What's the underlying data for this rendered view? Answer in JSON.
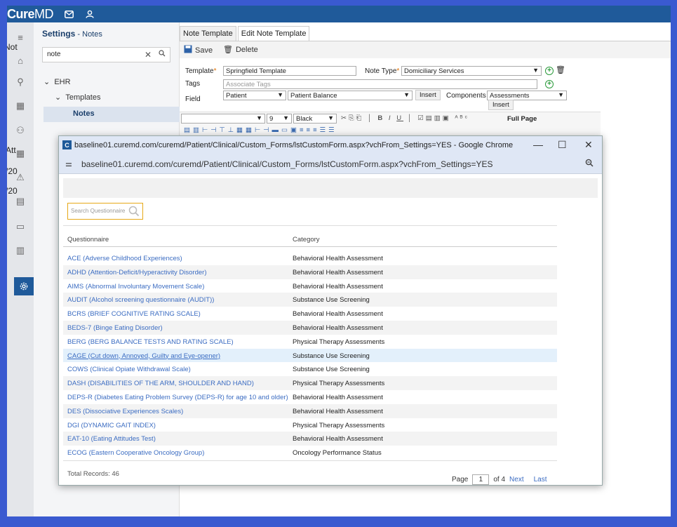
{
  "topbar": {
    "logo_bold": "Cure",
    "logo_rest": "MD"
  },
  "rail_cut_texts": [
    "Not",
    "Att",
    "/20",
    "/20"
  ],
  "settings": {
    "title": "Settings",
    "subtitle": " - Notes",
    "search_value": "note",
    "tree": {
      "ehr": "EHR",
      "templates": "Templates",
      "notes": "Notes"
    }
  },
  "tabs": [
    "Note Template",
    "Edit Note Template"
  ],
  "toolbar": {
    "save": "Save",
    "delete": "Delete"
  },
  "form": {
    "template_label": "Template",
    "template_value": "Springfield Template",
    "note_type_label": "Note Type",
    "note_type_value": "Domiciliary Services",
    "tags_label": "Tags",
    "tags_placeholder": "Associate Tags",
    "field_label": "Field",
    "field_value1": "Patient",
    "field_value2": "Patient Balance",
    "insert": "Insert",
    "components_label": "Components",
    "components_value": "Assessments",
    "insert2": "Insert"
  },
  "editor": {
    "size": "9",
    "color": "Black",
    "full_page": "Full Page"
  },
  "chrome": {
    "title": "baseline01.curemd.com/curemd/Patient/Clinical/Custom_Forms/lstCustomForm.aspx?vchFrom_Settings=YES - Google Chrome",
    "url": "baseline01.curemd.com/curemd/Patient/Clinical/Custom_Forms/lstCustomForm.aspx?vchFrom_Settings=YES"
  },
  "questionnaire": {
    "search_placeholder": "Search Questionnaire",
    "col_questionnaire": "Questionnaire",
    "col_category": "Category",
    "rows": [
      {
        "q": "ACE (Adverse Childhood Experiences)",
        "c": "Behavioral Health Assessment"
      },
      {
        "q": "ADHD (Attention-Deficit/Hyperactivity Disorder)",
        "c": "Behavioral Health Assessment"
      },
      {
        "q": "AIMS (Abnormal Involuntary Movement Scale)",
        "c": "Behavioral Health Assessment"
      },
      {
        "q": "AUDIT (Alcohol screening questionnaire (AUDIT))",
        "c": "Substance Use Screening"
      },
      {
        "q": "BCRS (BRIEF COGNITIVE RATING SCALE)",
        "c": "Behavioral Health Assessment"
      },
      {
        "q": "BEDS-7 (Binge Eating Disorder)",
        "c": "Behavioral Health Assessment"
      },
      {
        "q": "BERG (BERG BALANCE TESTS AND RATING SCALE)",
        "c": "Physical Therapy Assessments"
      },
      {
        "q": "CAGE (Cut down, Annoyed, Guilty and Eye-opener)",
        "c": "Substance Use Screening"
      },
      {
        "q": "COWS (Clinical Opiate Withdrawal Scale)",
        "c": "Substance Use Screening"
      },
      {
        "q": "DASH (DISABILITIES OF THE ARM, SHOULDER AND HAND)",
        "c": "Physical Therapy Assessments"
      },
      {
        "q": "DEPS-R (Diabetes Eating Problem Survey (DEPS-R) for age 10 and older)",
        "c": "Behavioral Health Assessment"
      },
      {
        "q": "DES (Dissociative Experiences Scales)",
        "c": "Behavioral Health Assessment"
      },
      {
        "q": "DGI (DYNAMIC GAIT INDEX)",
        "c": "Physical Therapy Assessments"
      },
      {
        "q": "EAT-10 (Eating Attitudes Test)",
        "c": "Behavioral Health Assessment"
      },
      {
        "q": "ECOG (Eastern Cooperative Oncology Group)",
        "c": "Oncology Performance Status"
      }
    ],
    "total": "Total Records: 46",
    "page_label": "Page",
    "page_value": "1",
    "of_label": "of 4",
    "next": "Next",
    "last": "Last"
  }
}
